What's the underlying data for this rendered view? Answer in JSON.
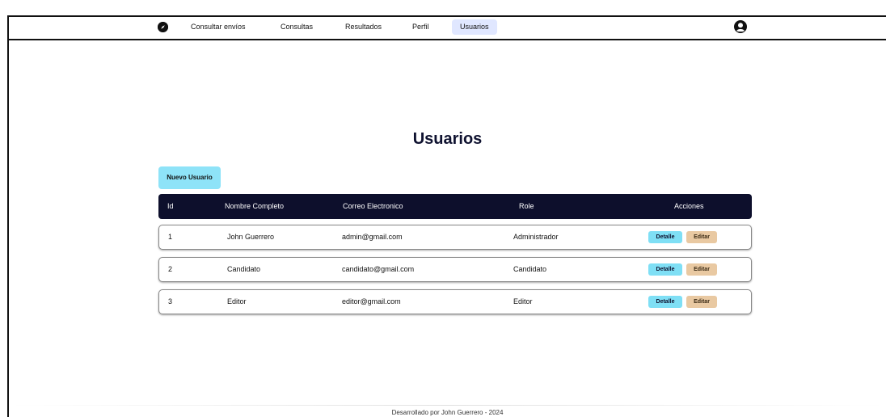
{
  "nav": {
    "items": [
      {
        "label": "Consultar envíos"
      },
      {
        "label": "Consultas"
      },
      {
        "label": "Resultados"
      },
      {
        "label": "Perfil"
      },
      {
        "label": "Usuarios",
        "active": true
      }
    ]
  },
  "page": {
    "title": "Usuarios",
    "new_button": "Nuevo Usuario"
  },
  "table": {
    "headers": [
      "Id",
      "Nombre Completo",
      "Correo Electronico",
      "Role",
      "Acciones"
    ],
    "rows": [
      {
        "id": "1",
        "name": "John Guerrero",
        "email": "admin@gmail.com",
        "role": "Administrador"
      },
      {
        "id": "2",
        "name": "Candidato",
        "email": "candidato@gmail.com",
        "role": "Candidato"
      },
      {
        "id": "3",
        "name": "Editor",
        "email": "editor@gmail.com",
        "role": "Editor"
      }
    ],
    "detail_label": "Detalle",
    "edit_label": "Editar"
  },
  "footer": {
    "text": "Desarrollado por John Guerrero - 2024"
  },
  "colors": {
    "header_bg": "#0d0f2c",
    "primary_button": "#8ee3f8",
    "detail_button": "#7fdff5",
    "edit_button": "#e9c9a2",
    "active_nav": "#e0e7ff"
  },
  "icons": {
    "logo": "compass-icon",
    "profile": "user-avatar-icon"
  }
}
